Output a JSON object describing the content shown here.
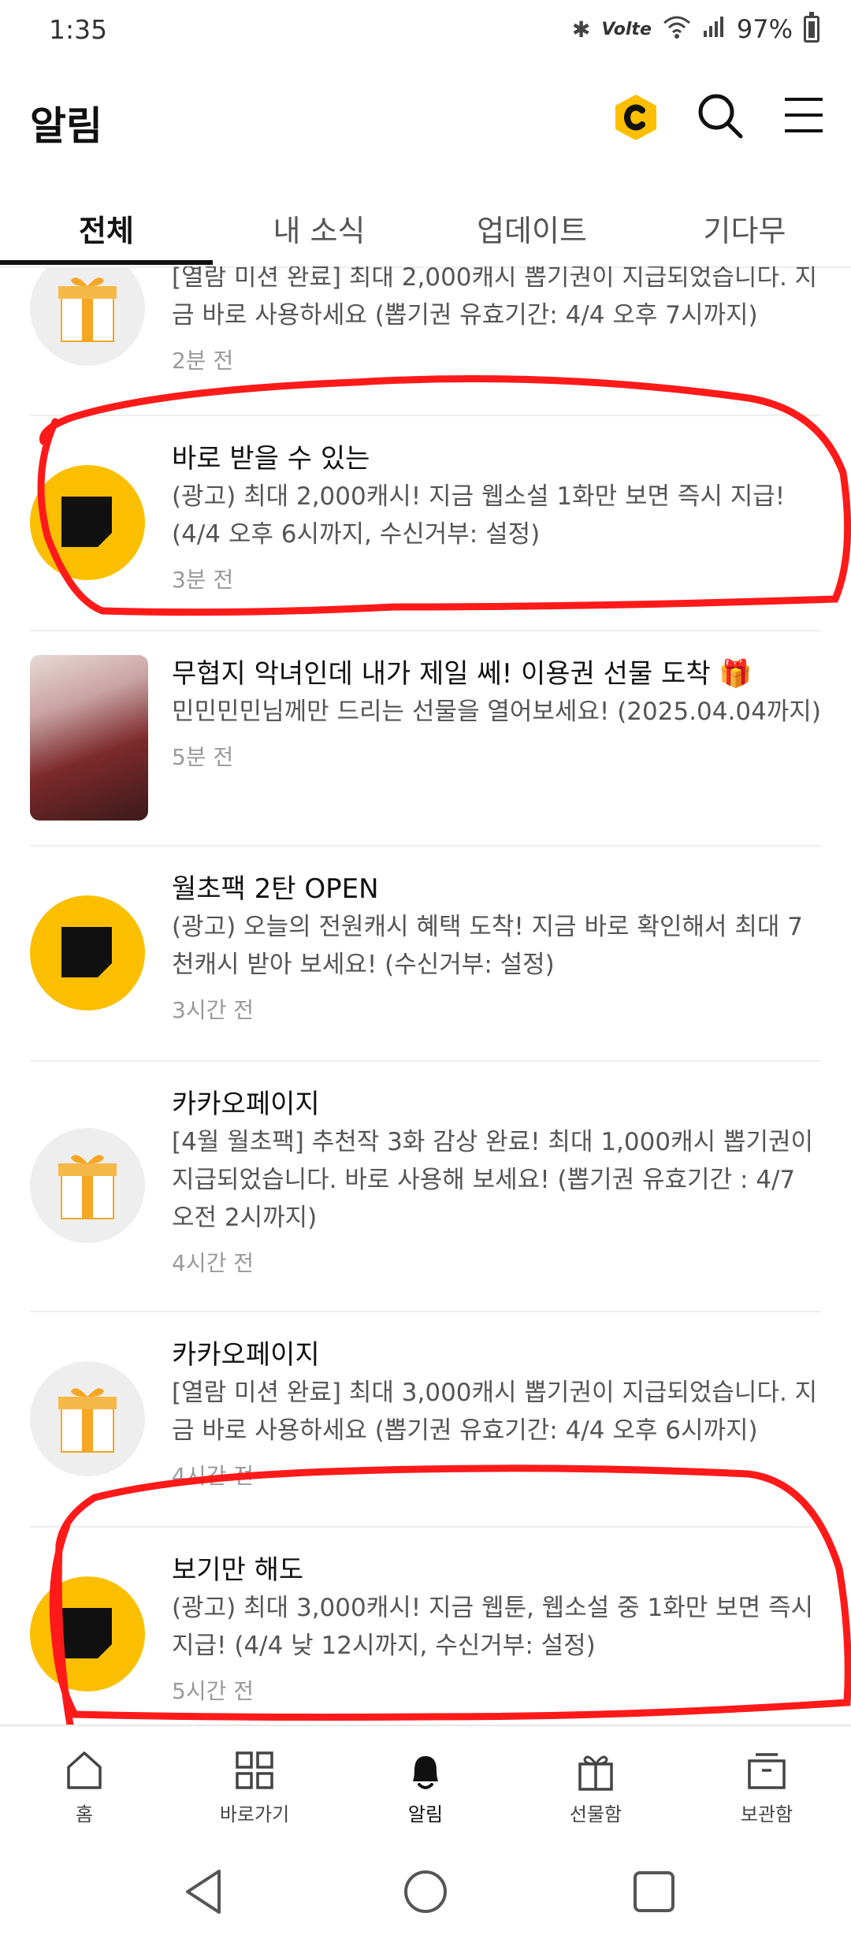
{
  "status_bar": {
    "time": "1:35",
    "network": "Volte",
    "battery": "97%"
  },
  "header": {
    "title": "알림",
    "cash_icon": "c-coin-icon",
    "search_icon": "search-icon",
    "menu_icon": "hamburger-menu-icon"
  },
  "tabs": [
    {
      "label": "전체",
      "active": true
    },
    {
      "label": "내 소식",
      "active": false
    },
    {
      "label": "업데이트",
      "active": false
    },
    {
      "label": "기다무",
      "active": false
    }
  ],
  "notifications": [
    {
      "icon": "gift-icon",
      "title": "",
      "body": "[열람 미션 완료] 최대 2,000캐시 뽑기권이 지급되었습니다. 지금 바로 사용하세요 (뽑기권 유효기간: 4/4 오후 7시까지)",
      "time": "2분 전"
    },
    {
      "icon": "kakaopage-logo-icon",
      "title": "바로 받을 수 있는",
      "body": "(광고) 최대 2,000캐시! 지금 웹소설 1화만 보면 즉시 지급! (4/4 오후 6시까지, 수신거부: 설정)",
      "time": "3분 전"
    },
    {
      "icon": "cover-thumbnail",
      "title": "무협지 악녀인데 내가 제일 쎄! 이용권 선물 도착 🎁",
      "body": "민민민민님께만 드리는 선물을 열어보세요! (2025.04.04까지)",
      "time": "5분 전"
    },
    {
      "icon": "kakaopage-logo-icon",
      "title": "월초팩 2탄 OPEN",
      "body": "(광고) 오늘의 전원캐시 혜택 도착! 지금 바로 확인해서 최대 7천캐시 받아 보세요! (수신거부: 설정)",
      "time": "3시간 전"
    },
    {
      "icon": "gift-icon",
      "title": "카카오페이지",
      "body": "[4월 월초팩] 추천작 3화 감상 완료! 최대 1,000캐시 뽑기권이 지급되었습니다. 바로 사용해 보세요! (뽑기권 유효기간 : 4/7 오전 2시까지)",
      "time": "4시간 전"
    },
    {
      "icon": "gift-icon",
      "title": "카카오페이지",
      "body": "[열람 미션 완료] 최대 3,000캐시 뽑기권이 지급되었습니다. 지금 바로 사용하세요 (뽑기권 유효기간: 4/4 오후 6시까지)",
      "time": "4시간 전"
    },
    {
      "icon": "kakaopage-logo-icon",
      "title": "보기만 해도",
      "body": "(광고) 최대 3,000캐시! 지금 웹툰, 웹소설 중 1화만 보면 즉시 지급! (4/4 낮 12시까지, 수신거부: 설정)",
      "time": "5시간 전"
    }
  ],
  "bottom_nav": [
    {
      "label": "홈",
      "icon": "home-icon"
    },
    {
      "label": "바로가기",
      "icon": "grid-icon"
    },
    {
      "label": "알림",
      "icon": "bell-icon",
      "active": true
    },
    {
      "label": "선물함",
      "icon": "gift-box-icon"
    },
    {
      "label": "보관함",
      "icon": "archive-icon"
    }
  ],
  "colors": {
    "brand_yellow": "#fbbf00",
    "annotation_red": "#ff1a1a",
    "divider": "#eeeeee"
  }
}
